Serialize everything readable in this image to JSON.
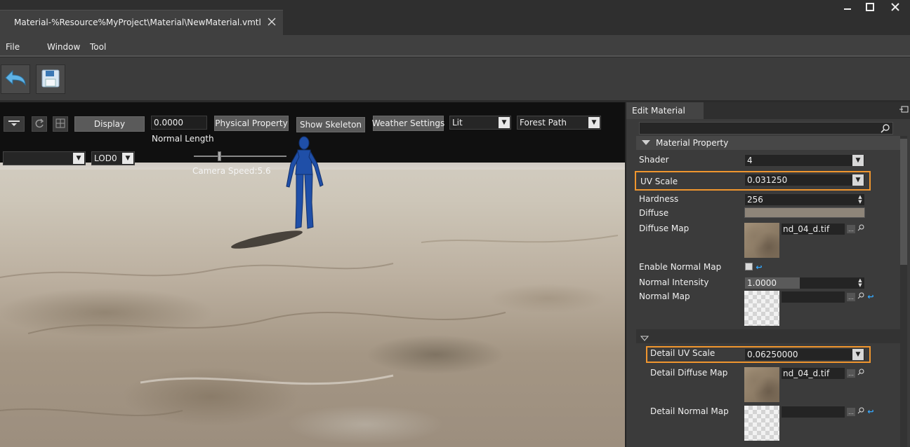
{
  "window": {
    "tab_title": "Material-%Resource%MyProject\\Material\\NewMaterial.vmtl"
  },
  "menu": {
    "items": [
      "File",
      "Window",
      "Tool"
    ]
  },
  "viewport": {
    "display_label": "Display",
    "normal_length_value": "0.0000",
    "normal_length_label": "Normal Length",
    "physical_property_label": "Physical Property",
    "show_skeleton_label": "Show Skeleton",
    "weather_settings_label": "Weather Settings",
    "lighting_mode": "Lit",
    "environment": "Forest Path",
    "lod": "LOD0",
    "camera_speed": "Camera Speed:5.6"
  },
  "panel": {
    "tab_title": "Edit Material",
    "section_title": "Material Property",
    "shader_label": "Shader",
    "shader_value": "4",
    "uv_scale_label": "UV Scale",
    "uv_scale_value": "0.031250",
    "hardness_label": "Hardness",
    "hardness_value": "256",
    "diffuse_label": "Diffuse",
    "diffuse_color": "#8e8579",
    "diffuse_map_label": "Diffuse Map",
    "diffuse_map_file": "nd_04_d.tif",
    "enable_normal_map_label": "Enable Normal Map",
    "normal_intensity_label": "Normal Intensity",
    "normal_intensity_value": "1.0000",
    "normal_map_label": "Normal Map",
    "detail_uv_scale_label": "Detail UV Scale",
    "detail_uv_scale_value": "0.06250000",
    "detail_diffuse_map_label": "Detail Diffuse Map",
    "detail_diffuse_map_file": "nd_04_d.tif",
    "detail_normal_map_label": "Detail Normal Map"
  },
  "colors": {
    "highlight": "#f0962e",
    "reset_icon": "#35a9ff",
    "character": "#1f4fa8"
  }
}
